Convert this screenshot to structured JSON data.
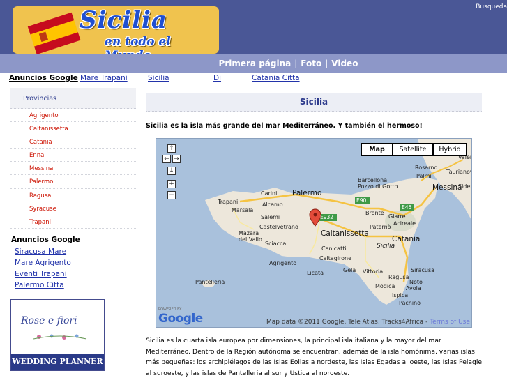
{
  "header": {
    "logo_title": "Sicilia",
    "logo_subtitle": "en todo el Mundo",
    "search_link": "Busqueda",
    "colors": {
      "header_bg": "#4a5796",
      "nav_bg": "#8d97c8",
      "logo_bg": "#f0c34e"
    }
  },
  "nav": {
    "items": [
      "Primera página",
      "Foto",
      "Video"
    ],
    "separator": "|"
  },
  "adbar": {
    "title": "Anuncios Google",
    "links": [
      "Mare Trapani",
      "Sicilia",
      "Di",
      "Catania Citta"
    ]
  },
  "sidebar": {
    "heading": "Provincias",
    "provinces": [
      "Agrigento",
      "Caltanissetta",
      "Catania",
      "Enna",
      "Messina",
      "Palermo",
      "Ragusa",
      "Syracuse",
      "Trapani"
    ]
  },
  "ads2": {
    "title": "Anuncios Google",
    "links": [
      "Siracusa Mare",
      "Mare Agrigento",
      "Eventi Trapani",
      "Palermo Citta"
    ]
  },
  "banner": {
    "logo_text": "Rose e fiori",
    "caption": "WEDDING PLANNER"
  },
  "content": {
    "heading": "Sicilia",
    "lead": "Sicilia es la isla más grande del mar Mediterráneo. Y también el hermoso!",
    "body": "Sicilia es la cuarta isla europea por dimensiones, la principal isla italiana y la mayor del mar Mediterráneo. Dentro de la Región autónoma se encuentran, además de la isla homónima, varias islas más pequeñas: los archipiélagos de las Islas Eolias a nordeste, las Islas Egadas al oeste, las Islas Pelagie al suroeste, y las islas de Pantelleria al sur y Ustica al noroeste."
  },
  "map": {
    "type_buttons": [
      "Map",
      "Satellite",
      "Hybrid"
    ],
    "selected_type": "Map",
    "controls": {
      "up": "↑",
      "left": "←",
      "right": "→",
      "down": "↓",
      "zoom_in": "+",
      "zoom_out": "−"
    },
    "powered_by": "POWERED BY",
    "google": "Google",
    "data_text": "Map data ©2011 Google, Tele Atlas, Tracks4Africa -",
    "terms": "Terms of Use",
    "road_labels": [
      "E90",
      "E932",
      "E45"
    ],
    "places": {
      "palermo": "Palermo",
      "catania": "Catania",
      "caltanissetta": "Caltanissetta",
      "messina": "Messina",
      "trapani": "Trapani",
      "marsala": "Marsala",
      "agrigento": "Agrigento",
      "siracusa": "Siracusa",
      "ragusa": "Ragusa",
      "gela": "Gela",
      "vittoria": "Vittoria",
      "noto": "Noto",
      "paterno": "Paternò",
      "caltagirone": "Caltagirone",
      "acireale": "Acireale",
      "giarre": "Giarre",
      "bronte": "Bronte",
      "sicilia": "Sicilia",
      "barcellona": "Barcellona Pozzo di Gotto",
      "rosarno": "Rosarno",
      "taurianova": "Taurianov",
      "palmi": "Palmi",
      "siderno": "Siderno",
      "carini": "Carini",
      "alcamo": "Alcamo",
      "salemi": "Salemi",
      "castelvetrano": "Castelvetrano",
      "mazara": "Mazara del Vallo",
      "sciacca": "Sciacca",
      "canicatti": "Canicattì",
      "licata": "Licata",
      "modica": "Modica",
      "avola": "Avola",
      "ispica": "Ispica",
      "pachino": "Pachino",
      "pantelleria": "Pantelleria",
      "valentia": "Valentia"
    }
  }
}
